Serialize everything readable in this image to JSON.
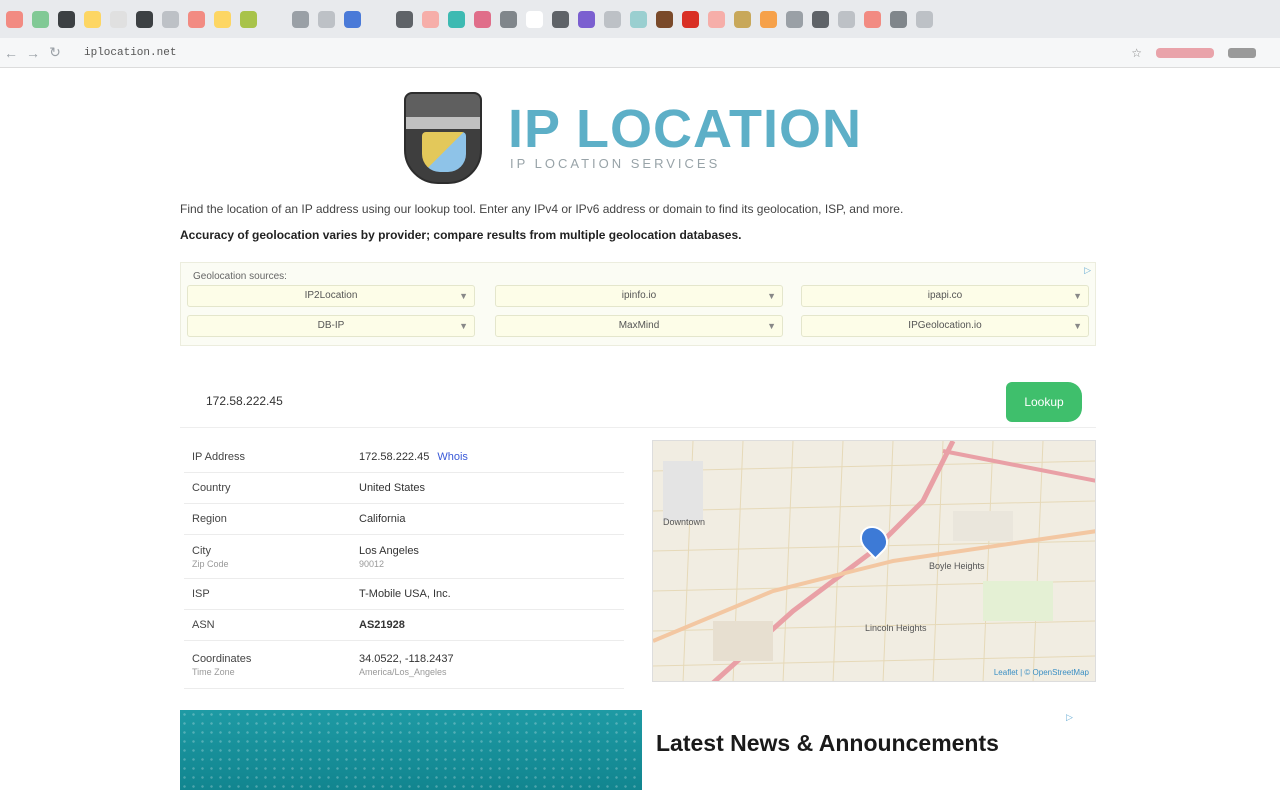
{
  "browser": {
    "favicon_colors": [
      "#f28b82",
      "#81c995",
      "#3c4043",
      "#fdd663",
      "#e0e0e0",
      "#3c4043",
      "#bdc1c6",
      "#f28b82",
      "#fdd663",
      "#a8c34a",
      "#e8eaed",
      "#9aa0a6",
      "#bdc1c6",
      "#4a7ad8",
      "#e8eaed",
      "#5f6368",
      "#f6aea9",
      "#3dbab2",
      "#e06e8a",
      "#80868b",
      "#ffffff",
      "#5f6368",
      "#7b5fd0",
      "#bdc1c6",
      "#9acfd0",
      "#7a4a2a",
      "#d93025",
      "#f6aea9",
      "#c8a85a",
      "#f6a14a",
      "#9aa0a6",
      "#5f6368",
      "#bdc1c6",
      "#f28b82",
      "#80868b",
      "#bdc1c6"
    ],
    "url": "iplocation.net",
    "nav": {
      "back_icon": "arrow-left-icon",
      "forward_icon": "arrow-right-icon",
      "reload_icon": "reload-icon"
    }
  },
  "header": {
    "logo_title": "IP LOCATION",
    "logo_sub": "IP LOCATION SERVICES"
  },
  "intro": {
    "line1": "Find the location of an IP address using our lookup tool. Enter any IPv4 or IPv6 address or domain to find its geolocation, ISP, and more.",
    "line2": "Accuracy of geolocation varies by provider; compare results from multiple geolocation databases."
  },
  "sources": {
    "label": "Geolocation sources:",
    "adchoice": "▷",
    "row1": [
      "IP2Location",
      "ipinfo.io",
      "ipapi.co"
    ],
    "row2": [
      "DB-IP",
      "MaxMind",
      "IPGeolocation.io"
    ]
  },
  "search": {
    "value": "172.58.222.45",
    "button": "Lookup"
  },
  "info": {
    "rows": [
      {
        "key": "IP Address",
        "value": "172.58.222.45",
        "link": "Whois"
      },
      {
        "key": "Country",
        "value": "United States"
      },
      {
        "key": "Region",
        "value": "California"
      },
      {
        "key": "City",
        "value": "Los Angeles",
        "key_sub": "Zip Code",
        "value_sub": "90012"
      },
      {
        "key": "ISP",
        "value": "T-Mobile USA, Inc."
      },
      {
        "key": "ASN",
        "value": "AS21928"
      },
      {
        "key": "Coordinates",
        "value": "34.0522, -118.2437",
        "key_sub": "Time Zone",
        "value_sub": "America/Los_Angeles"
      }
    ]
  },
  "map": {
    "label_1": "Downtown",
    "label_2": "Boyle Heights",
    "label_3": "Lincoln Heights",
    "attribution": "Leaflet | © OpenStreetMap"
  },
  "news": {
    "headline": "Latest News & Announcements",
    "adchoice": "▷"
  }
}
